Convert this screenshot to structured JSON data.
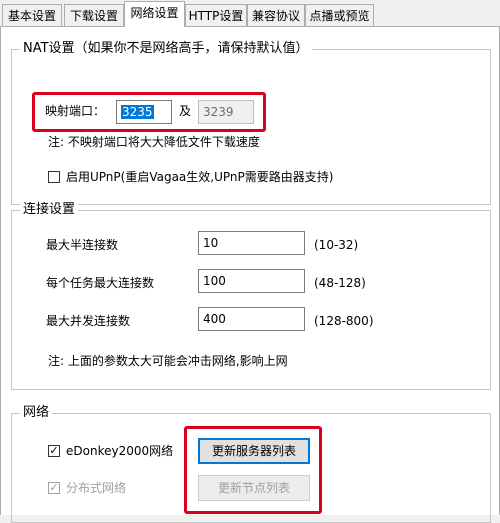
{
  "tabs": [
    {
      "label": "基本设置",
      "active": false
    },
    {
      "label": "下载设置",
      "active": false
    },
    {
      "label": "网络设置",
      "active": true
    },
    {
      "label": "HTTP设置",
      "active": false
    },
    {
      "label": "兼容协议",
      "active": false
    },
    {
      "label": "点播或预览",
      "active": false
    }
  ],
  "nat": {
    "legend": "NAT设置（如果你不是网络高手，请保持默认值）",
    "port_label": "映射端口：",
    "port_value": "3235",
    "and_label": "及",
    "port2_value": "3239",
    "note": "注: 不映射端口将大大降低文件下载速度",
    "upnp_label": "启用UPnP(重启Vagaa生效,UPnP需要路由器支持)",
    "upnp_checked": false
  },
  "conn": {
    "legend": "连接设置",
    "rows": [
      {
        "label": "最大半连接数",
        "value": "10",
        "range": "(10-32)"
      },
      {
        "label": "每个任务最大连接数",
        "value": "100",
        "range": "(48-128)"
      },
      {
        "label": "最大并发连接数",
        "value": "400",
        "range": "(128-800)"
      }
    ],
    "note": "注: 上面的参数太大可能会冲击网络,影响上网"
  },
  "net": {
    "legend": "网络",
    "edonkey_label": "eDonkey2000网络",
    "edonkey_checked": true,
    "distributed_label": "分布式网络",
    "distributed_checked": true,
    "update_servers_label": "更新服务器列表",
    "update_nodes_label": "更新节点列表"
  },
  "check_mark": "✓",
  "colors": {
    "highlight_box": "#d9001b",
    "selection": "#0078d7"
  }
}
